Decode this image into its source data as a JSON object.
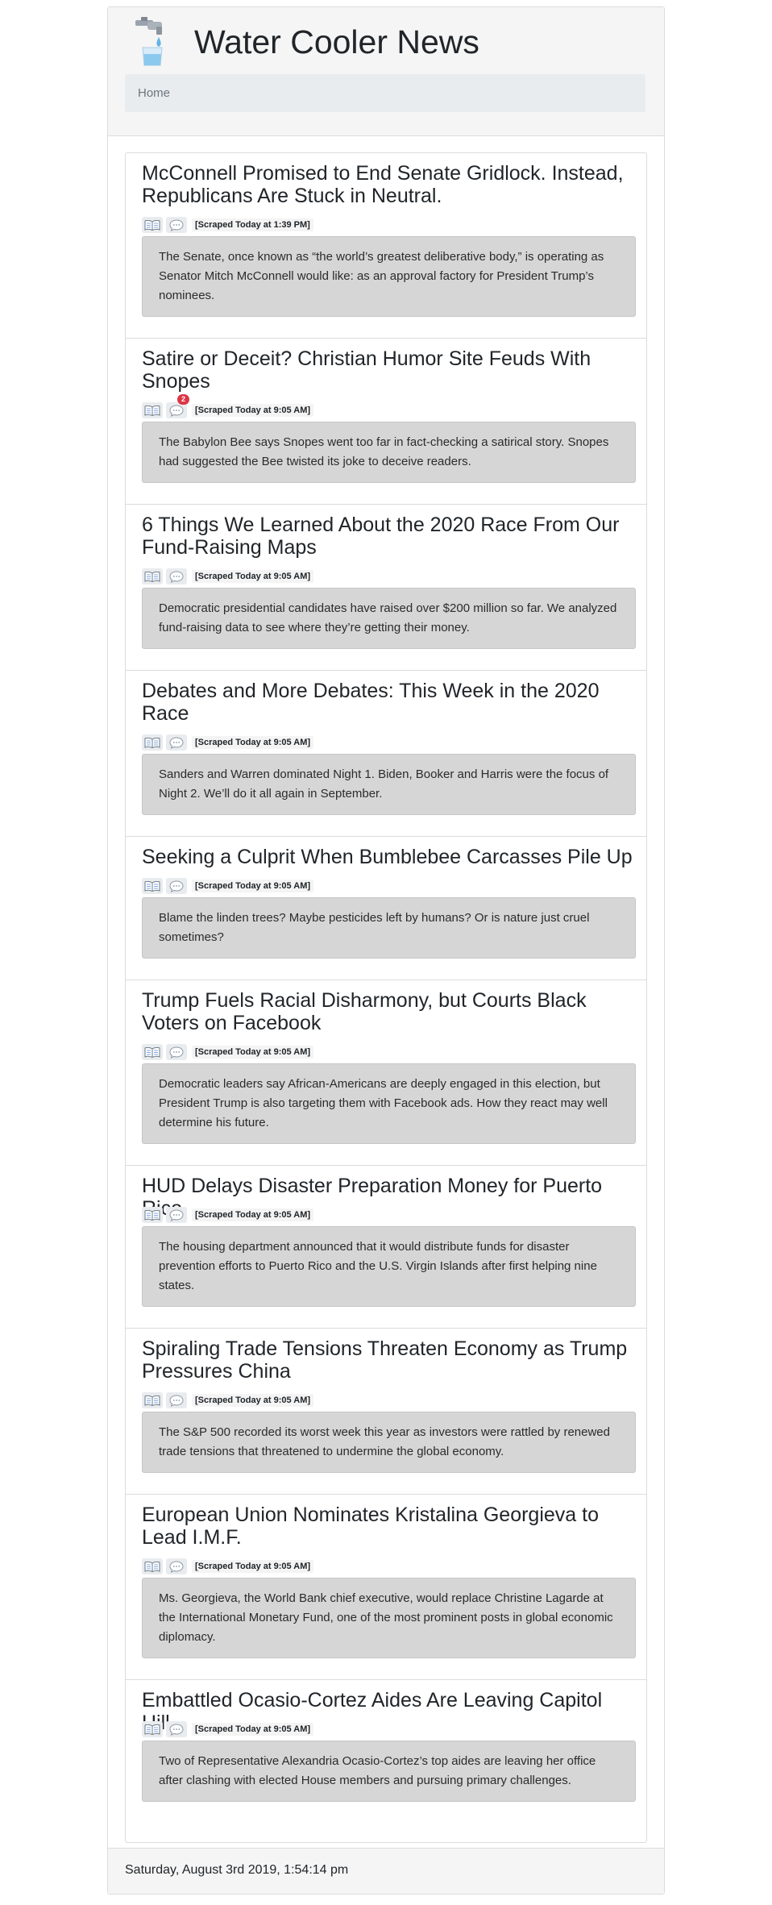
{
  "app": {
    "title": "Water Cooler News",
    "logo_icon": "water-faucet-icon"
  },
  "nav": {
    "items": [
      {
        "label": "Home"
      }
    ]
  },
  "icons": {
    "read": "open-book-icon",
    "comments": "speech-bubble-icon"
  },
  "colors": {
    "badge": "#dc3545",
    "summary_background": "#d6d6d7"
  },
  "articles": [
    {
      "title": "McConnell Promised to End Senate Gridlock. Instead, Republicans Are Stuck in Neutral.",
      "scraped": "[Scraped Today at 1:39 PM]",
      "summary": "The Senate, once known as “the world’s greatest deliberative body,” is operating as Senator Mitch McConnell would like: as an approval factory for President Trump’s nominees.",
      "comment_count": ""
    },
    {
      "title": "Satire or Deceit? Christian Humor Site Feuds With Snopes",
      "scraped": "[Scraped Today at 9:05 AM]",
      "summary": "The Babylon Bee says Snopes went too far in fact-checking a satirical story. Snopes had suggested the Bee twisted its joke to deceive readers.",
      "comment_count": "2"
    },
    {
      "title": "6 Things We Learned About the 2020 Race From Our Fund-Raising Maps",
      "scraped": "[Scraped Today at 9:05 AM]",
      "summary": "Democratic presidential candidates have raised over $200 million so far. We analyzed fund-raising data to see where they’re getting their money.",
      "comment_count": ""
    },
    {
      "title": "Debates and More Debates: This Week in the 2020 Race",
      "scraped": "[Scraped Today at 9:05 AM]",
      "summary": "Sanders and Warren dominated Night 1. Biden, Booker and Harris were the focus of Night 2. We’ll do it all again in September.",
      "comment_count": ""
    },
    {
      "title": "Seeking a Culprit When Bumblebee Carcasses Pile Up",
      "scraped": "[Scraped Today at 9:05 AM]",
      "summary": "Blame the linden trees? Maybe pesticides left by humans? Or is nature just cruel sometimes?",
      "comment_count": ""
    },
    {
      "title": "Trump Fuels Racial Disharmony, but Courts Black Voters on Facebook",
      "scraped": "[Scraped Today at 9:05 AM]",
      "summary": "Democratic leaders say African-Americans are deeply engaged in this election, but President Trump is also targeting them with Facebook ads. How they react may well determine his future.",
      "comment_count": ""
    },
    {
      "title": "HUD Delays Disaster Preparation Money for Puerto Rico",
      "scraped": "[Scraped Today at 9:05 AM]",
      "summary": "The housing department announced that it would distribute funds for disaster prevention efforts to Puerto Rico and the U.S. Virgin Islands after first helping nine states.",
      "comment_count": ""
    },
    {
      "title": "Spiraling Trade Tensions Threaten Economy as Trump Pressures China",
      "scraped": "[Scraped Today at 9:05 AM]",
      "summary": "The S&P 500 recorded its worst week this year as investors were rattled by renewed trade tensions that threatened to undermine the global economy.",
      "comment_count": ""
    },
    {
      "title": "European Union Nominates Kristalina Georgieva to Lead I.M.F.",
      "scraped": "[Scraped Today at 9:05 AM]",
      "summary": "Ms. Georgieva, the World Bank chief executive, would replace Christine Lagarde at the International Monetary Fund, one of the most prominent posts in global economic diplomacy.",
      "comment_count": ""
    },
    {
      "title": "Embattled Ocasio-Cortez Aides Are Leaving Capitol Hill",
      "scraped": "[Scraped Today at 9:05 AM]",
      "summary": "Two of Representative Alexandria Ocasio-Cortez’s top aides are leaving her office after clashing with elected House members and pursuing primary challenges.",
      "comment_count": ""
    }
  ],
  "footer": {
    "timestamp": "Saturday, August 3rd 2019, 1:54:14 pm"
  }
}
